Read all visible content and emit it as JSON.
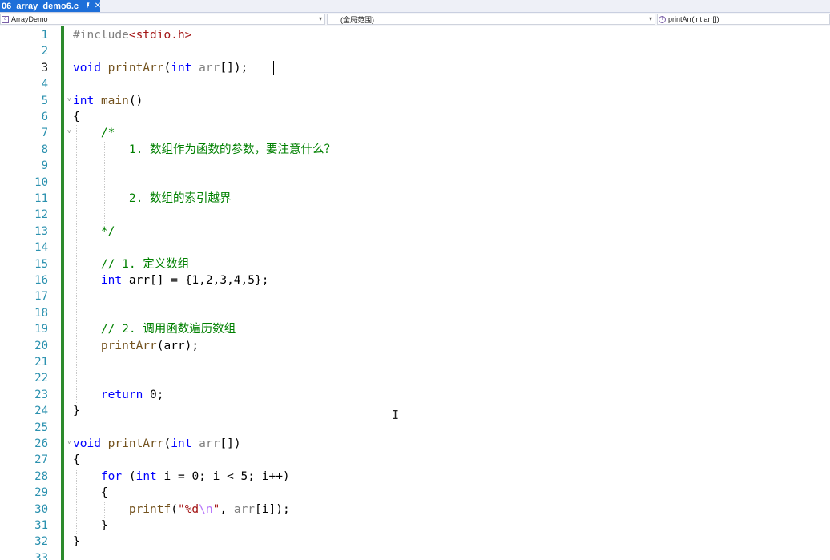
{
  "tab": {
    "title": "06_array_demo6.c",
    "pin_icon": "pin-icon",
    "close_icon": "close-icon"
  },
  "nav": {
    "project": "ArrayDemo",
    "scope": "(全局范围)",
    "member": "printArr(int arr[])"
  },
  "colors": {
    "accent": "#1e6fd9",
    "change_bar": "#2c8a2c",
    "line_numbers": "#2b91af",
    "keyword": "#0000ff",
    "comment": "#008000",
    "string": "#a31515"
  },
  "current_line": 3,
  "lines": [
    {
      "n": "1",
      "t": [
        [
          "pre",
          "#include"
        ],
        [
          "str",
          "<stdio.h>"
        ]
      ]
    },
    {
      "n": "2",
      "t": []
    },
    {
      "n": "3",
      "t": [
        [
          "kw",
          "void"
        ],
        [
          "",
          " "
        ],
        [
          "fn",
          "printArr"
        ],
        [
          "",
          "("
        ],
        [
          "kw",
          "int"
        ],
        [
          "",
          " "
        ],
        [
          "prm",
          "arr"
        ],
        [
          "",
          "[]);"
        ]
      ]
    },
    {
      "n": "4",
      "t": []
    },
    {
      "n": "5",
      "t": [
        [
          "kw",
          "int"
        ],
        [
          "",
          " "
        ],
        [
          "fn",
          "main"
        ],
        [
          "",
          "()"
        ]
      ]
    },
    {
      "n": "6",
      "t": [
        [
          "",
          "{"
        ]
      ]
    },
    {
      "n": "7",
      "t": [
        [
          "",
          "    "
        ],
        [
          "cm",
          "/*"
        ]
      ]
    },
    {
      "n": "8",
      "t": [
        [
          "",
          "        "
        ],
        [
          "cm",
          "1. 数组作为函数的参数，要注意什么？"
        ]
      ]
    },
    {
      "n": "9",
      "t": []
    },
    {
      "n": "10",
      "t": []
    },
    {
      "n": "11",
      "t": [
        [
          "",
          "        "
        ],
        [
          "cm",
          "2. 数组的索引越界"
        ]
      ]
    },
    {
      "n": "12",
      "t": []
    },
    {
      "n": "13",
      "t": [
        [
          "",
          "    "
        ],
        [
          "cm",
          "*/"
        ]
      ]
    },
    {
      "n": "14",
      "t": []
    },
    {
      "n": "15",
      "t": [
        [
          "",
          "    "
        ],
        [
          "cm",
          "// 1. 定义数组"
        ]
      ]
    },
    {
      "n": "16",
      "t": [
        [
          "",
          "    "
        ],
        [
          "kw",
          "int"
        ],
        [
          "",
          " "
        ],
        [
          "",
          "arr[] = {1,2,3,4,5};"
        ]
      ]
    },
    {
      "n": "17",
      "t": []
    },
    {
      "n": "18",
      "t": []
    },
    {
      "n": "19",
      "t": [
        [
          "",
          "    "
        ],
        [
          "cm",
          "// 2. 调用函数遍历数组"
        ]
      ]
    },
    {
      "n": "20",
      "t": [
        [
          "",
          "    "
        ],
        [
          "fn",
          "printArr"
        ],
        [
          "",
          "(arr);"
        ]
      ]
    },
    {
      "n": "21",
      "t": []
    },
    {
      "n": "22",
      "t": []
    },
    {
      "n": "23",
      "t": [
        [
          "",
          "    "
        ],
        [
          "kw",
          "return"
        ],
        [
          "",
          " "
        ],
        [
          "",
          "0;"
        ]
      ]
    },
    {
      "n": "24",
      "t": [
        [
          "",
          "}"
        ]
      ]
    },
    {
      "n": "25",
      "t": []
    },
    {
      "n": "26",
      "t": [
        [
          "kw",
          "void"
        ],
        [
          "",
          " "
        ],
        [
          "fn",
          "printArr"
        ],
        [
          "",
          "("
        ],
        [
          "kw",
          "int"
        ],
        [
          "",
          " "
        ],
        [
          "prm",
          "arr"
        ],
        [
          "",
          "[])"
        ]
      ]
    },
    {
      "n": "27",
      "t": [
        [
          "",
          "{"
        ]
      ]
    },
    {
      "n": "28",
      "t": [
        [
          "",
          "    "
        ],
        [
          "kw",
          "for"
        ],
        [
          "",
          " ("
        ],
        [
          "kw",
          "int"
        ],
        [
          "",
          " i = 0; i < 5; i++)"
        ]
      ]
    },
    {
      "n": "29",
      "t": [
        [
          "",
          "    {"
        ]
      ]
    },
    {
      "n": "30",
      "t": [
        [
          "",
          "        "
        ],
        [
          "fn",
          "printf"
        ],
        [
          "",
          "("
        ],
        [
          "str",
          "\"%d"
        ],
        [
          "esc",
          "\\n"
        ],
        [
          "str",
          "\""
        ],
        [
          "",
          ", "
        ],
        [
          "prm",
          "arr"
        ],
        [
          "",
          "[i]);"
        ]
      ]
    },
    {
      "n": "31",
      "t": [
        [
          "",
          "    }"
        ]
      ]
    },
    {
      "n": "32",
      "t": [
        [
          "",
          "}"
        ]
      ]
    },
    {
      "n": "33",
      "t": []
    }
  ]
}
